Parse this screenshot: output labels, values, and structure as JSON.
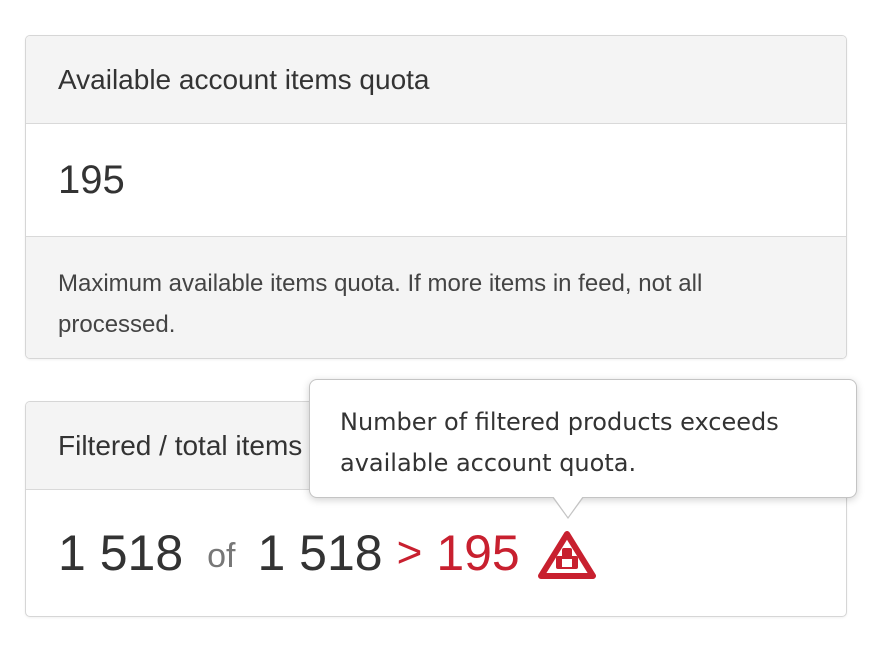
{
  "quota_card": {
    "title": "Available account items quota",
    "value": "195",
    "description": "Maximum available items quota. If more items in feed, not all processed."
  },
  "filtered_card": {
    "title": "Filtered / total items",
    "filtered_count": "1 518",
    "of_label": "of",
    "total_count": "1 518",
    "comparison": ">",
    "quota_limit": "195",
    "warning_icon": "warning-triangle-icon"
  },
  "tooltip": {
    "text": "Number of filtered products exceeds available account quota."
  },
  "colors": {
    "warning": "#c8202f",
    "header_bg": "#f4f4f4",
    "border": "#d6d6d6"
  }
}
